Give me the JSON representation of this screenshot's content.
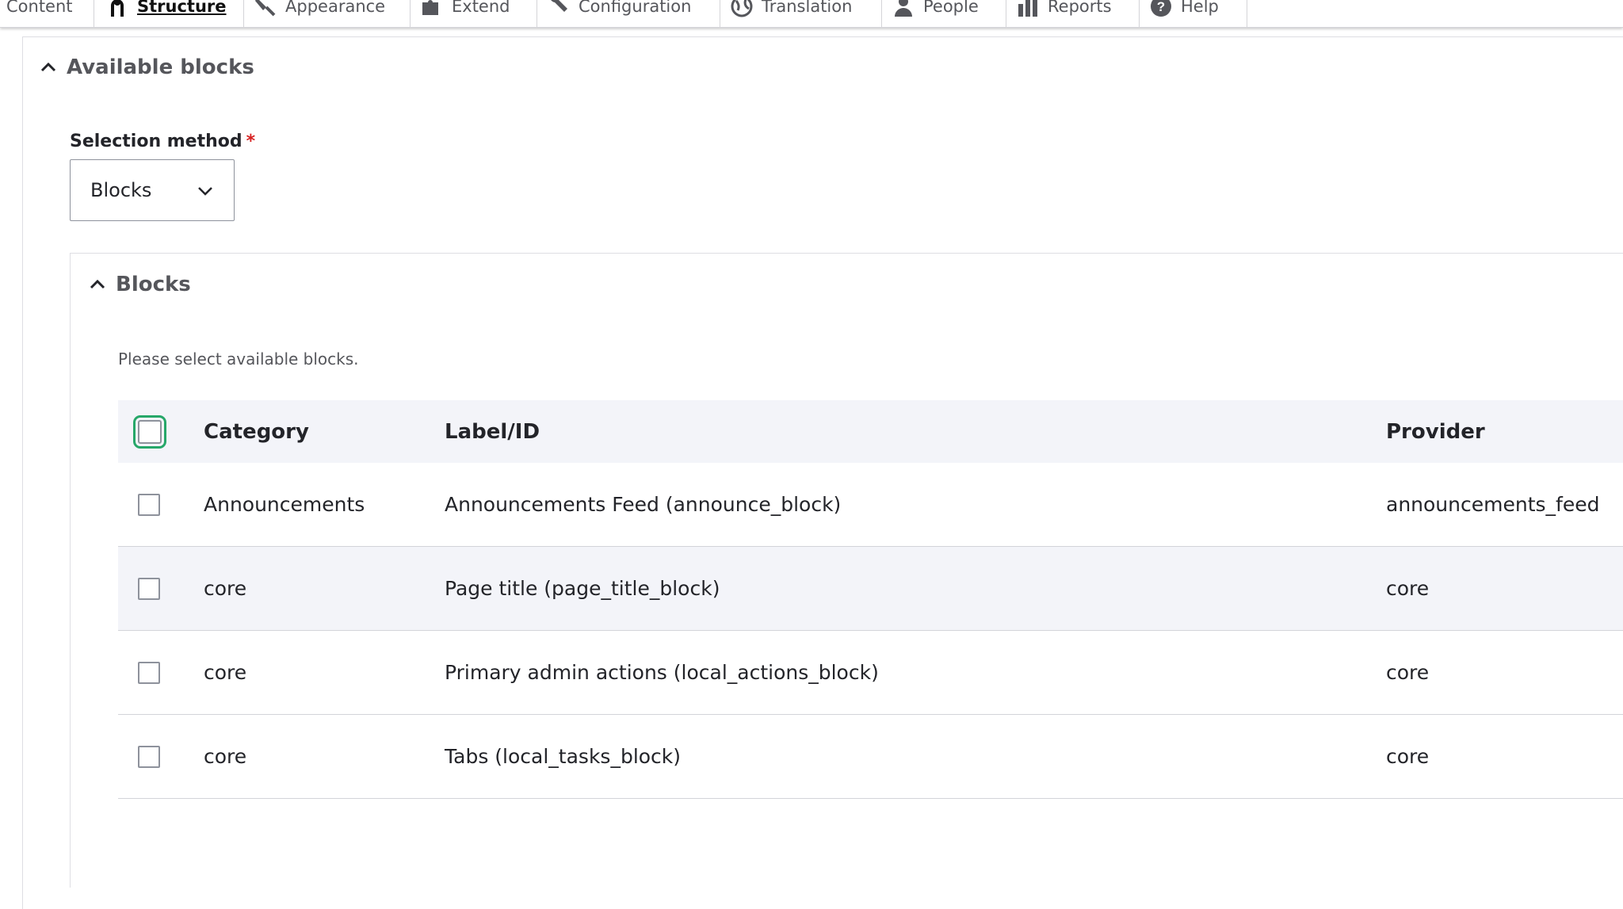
{
  "toolbar": {
    "items": [
      {
        "label": "Content",
        "icon": "none"
      },
      {
        "label": "Structure",
        "icon": "structure-icon",
        "active": true
      },
      {
        "label": "Appearance",
        "icon": "appearance-brush-icon"
      },
      {
        "label": "Extend",
        "icon": "extend-puzzle-icon"
      },
      {
        "label": "Configuration",
        "icon": "configuration-wrench-icon"
      },
      {
        "label": "Translation",
        "icon": "translation-globe-icon"
      },
      {
        "label": "People",
        "icon": "people-icon"
      },
      {
        "label": "Reports",
        "icon": "reports-bars-icon"
      },
      {
        "label": "Help",
        "icon": "help-question-icon"
      }
    ]
  },
  "available_blocks": {
    "summary": "Available blocks",
    "selection_method": {
      "label": "Selection method",
      "required_marker": "*",
      "value": "Blocks"
    },
    "blocks_group": {
      "summary": "Blocks",
      "description": "Please select available blocks.",
      "table": {
        "headers": {
          "category": "Category",
          "label_id": "Label/ID",
          "provider": "Provider"
        },
        "rows": [
          {
            "category": "Announcements",
            "label_id": "Announcements Feed (announce_block)",
            "provider": "announcements_feed",
            "checked": false
          },
          {
            "category": "core",
            "label_id": "Page title (page_title_block)",
            "provider": "core",
            "checked": false
          },
          {
            "category": "core",
            "label_id": "Primary admin actions (local_actions_block)",
            "provider": "core",
            "checked": false
          },
          {
            "category": "core",
            "label_id": "Tabs (local_tasks_block)",
            "provider": "core",
            "checked": false
          }
        ]
      }
    }
  },
  "colors": {
    "focus_ring": "#26a769",
    "required": "#d72222",
    "header_bg": "#f3f4f9",
    "text": "#232429",
    "muted_text": "#55565b"
  }
}
